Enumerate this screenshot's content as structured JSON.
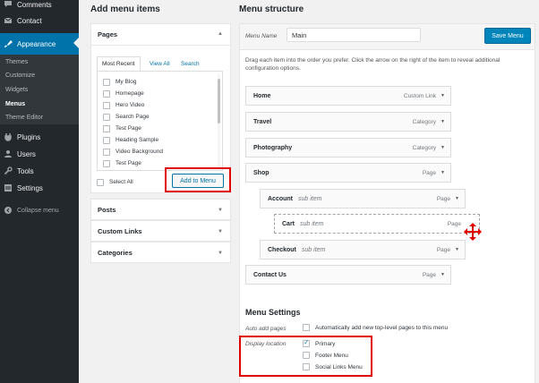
{
  "sidebar": {
    "items": [
      {
        "label": "Comments",
        "icon": "comments-icon"
      },
      {
        "label": "Contact",
        "icon": "mail-icon"
      },
      {
        "label": "Appearance",
        "icon": "brush-icon"
      },
      {
        "label": "Plugins",
        "icon": "plugin-icon"
      },
      {
        "label": "Users",
        "icon": "users-icon"
      },
      {
        "label": "Tools",
        "icon": "wrench-icon"
      },
      {
        "label": "Settings",
        "icon": "settings-icon"
      },
      {
        "label": "Collapse menu",
        "icon": "collapse-icon"
      }
    ],
    "submenu": [
      "Themes",
      "Customize",
      "Widgets",
      "Menus",
      "Theme Editor"
    ],
    "active": "Appearance",
    "current_sub": "Menus"
  },
  "add_items": {
    "heading": "Add menu items",
    "pages_title": "Pages",
    "tabs": [
      "Most Recent",
      "View All",
      "Search"
    ],
    "pages": [
      "My Blog",
      "Homepage",
      "Hero Video",
      "Search Page",
      "Test Page",
      "Heading Sample",
      "Video Background",
      "Test Page"
    ],
    "select_all": "Select All",
    "add_button": "Add to Menu",
    "sections": [
      "Posts",
      "Custom Links",
      "Categories"
    ]
  },
  "structure": {
    "heading": "Menu structure",
    "name_label": "Menu Name",
    "name_value": "Main",
    "save_button": "Save Menu",
    "instructions": "Drag each item into the order you prefer. Click the arrow on the right of the item to reveal additional configuration options.",
    "sub_label": "sub item",
    "items": [
      {
        "title": "Home",
        "type": "Custom Link"
      },
      {
        "title": "Travel",
        "type": "Category"
      },
      {
        "title": "Photography",
        "type": "Category"
      },
      {
        "title": "Shop",
        "type": "Page"
      },
      {
        "title": "Account",
        "type": "Page"
      },
      {
        "title": "Cart",
        "type": "Page"
      },
      {
        "title": "Checkout",
        "type": "Page"
      },
      {
        "title": "Contact Us",
        "type": "Page"
      }
    ]
  },
  "settings": {
    "title": "Menu Settings",
    "auto_label": "Auto add pages",
    "auto_text": "Automatically add new top-level pages to this menu",
    "display_label": "Display location",
    "locations": [
      {
        "label": "Primary",
        "checked": true
      },
      {
        "label": "Footer Menu",
        "checked": false
      },
      {
        "label": "Social Links Menu",
        "checked": false
      }
    ]
  },
  "colors": {
    "accent": "#0073aa",
    "highlight": "#e00000",
    "sidebar": "#23282d"
  }
}
